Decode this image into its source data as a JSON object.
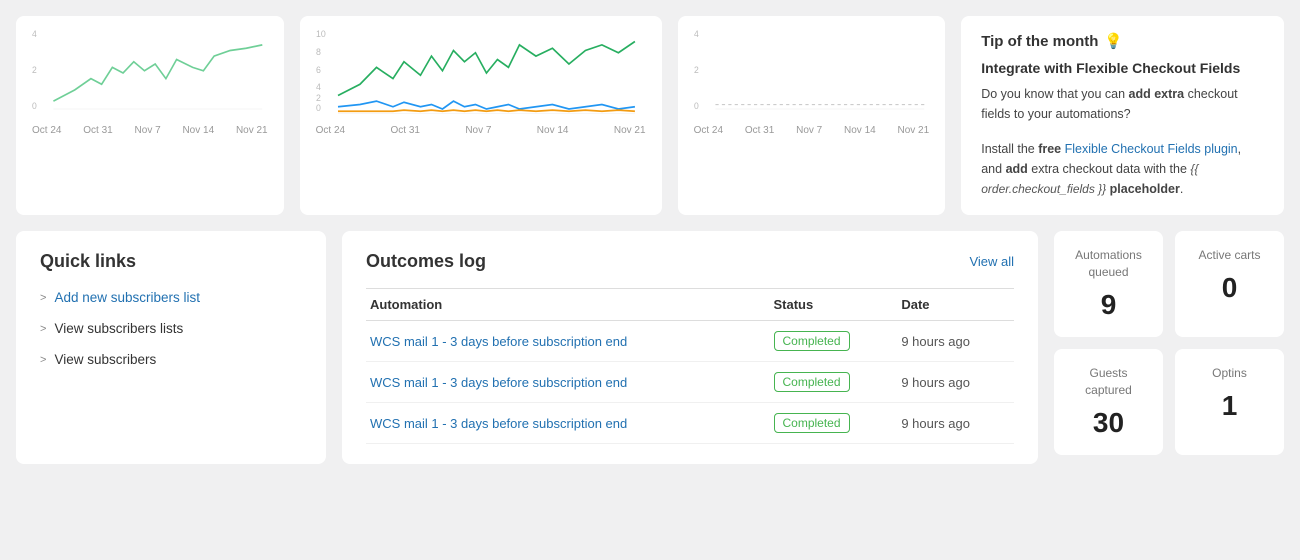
{
  "charts": {
    "chart1": {
      "x_labels": [
        "Oct 24",
        "Oct 31",
        "Nov 7",
        "Nov 14",
        "Nov 21"
      ],
      "y_max": 4,
      "y_labels": [
        "4",
        "2",
        "0"
      ]
    },
    "chart2": {
      "x_labels": [
        "Oct 24",
        "Oct 31",
        "Nov 7",
        "Nov 14",
        "Nov 21"
      ],
      "y_max": 10,
      "y_labels": [
        "10",
        "8",
        "6",
        "4",
        "2",
        "0"
      ]
    },
    "chart3": {
      "x_labels": [
        "Oct 24",
        "Oct 31",
        "Nov 7",
        "Nov 14",
        "Nov 21"
      ],
      "y_max": 4,
      "y_labels": [
        "4",
        "2",
        "0"
      ]
    }
  },
  "tip": {
    "title": "Tip of the month",
    "icon": "💡",
    "subtitle": "Integrate with Flexible Checkout Fields",
    "body1": "Do you know that you can",
    "body1_bold": "add extra",
    "body1_end": "checkout fields to your automations?",
    "body2_start": "Install the",
    "body2_free": "free",
    "body2_link": "Flexible Checkout Fields plugin",
    "body2_mid": ", and",
    "body2_bold": "add",
    "body2_rest": "extra checkout data with the",
    "body2_code": "{{ order.checkout_fields }}",
    "body2_end": "placeholder."
  },
  "quick_links": {
    "title": "Quick links",
    "items": [
      {
        "label": "Add new subscribers list",
        "link": true
      },
      {
        "label": "View subscribers lists",
        "link": false
      },
      {
        "label": "View subscribers",
        "link": false
      }
    ]
  },
  "outcomes_log": {
    "title": "Outcomes log",
    "view_all": "View all",
    "columns": [
      "Automation",
      "Status",
      "Date"
    ],
    "rows": [
      {
        "automation": "WCS mail 1 - 3 days before subscription end",
        "status": "Completed",
        "date": "9 hours ago"
      },
      {
        "automation": "WCS mail 1 - 3 days before subscription end",
        "status": "Completed",
        "date": "9 hours ago"
      },
      {
        "automation": "WCS mail 1 - 3 days before subscription end",
        "status": "Completed",
        "date": "9 hours ago"
      }
    ]
  },
  "stats": {
    "automations_queued": {
      "label": "Automations queued",
      "value": "9"
    },
    "active_carts": {
      "label": "Active carts",
      "value": "0"
    },
    "guests_captured": {
      "label": "Guests captured",
      "value": "30"
    },
    "optins": {
      "label": "Optins",
      "value": "1"
    }
  }
}
